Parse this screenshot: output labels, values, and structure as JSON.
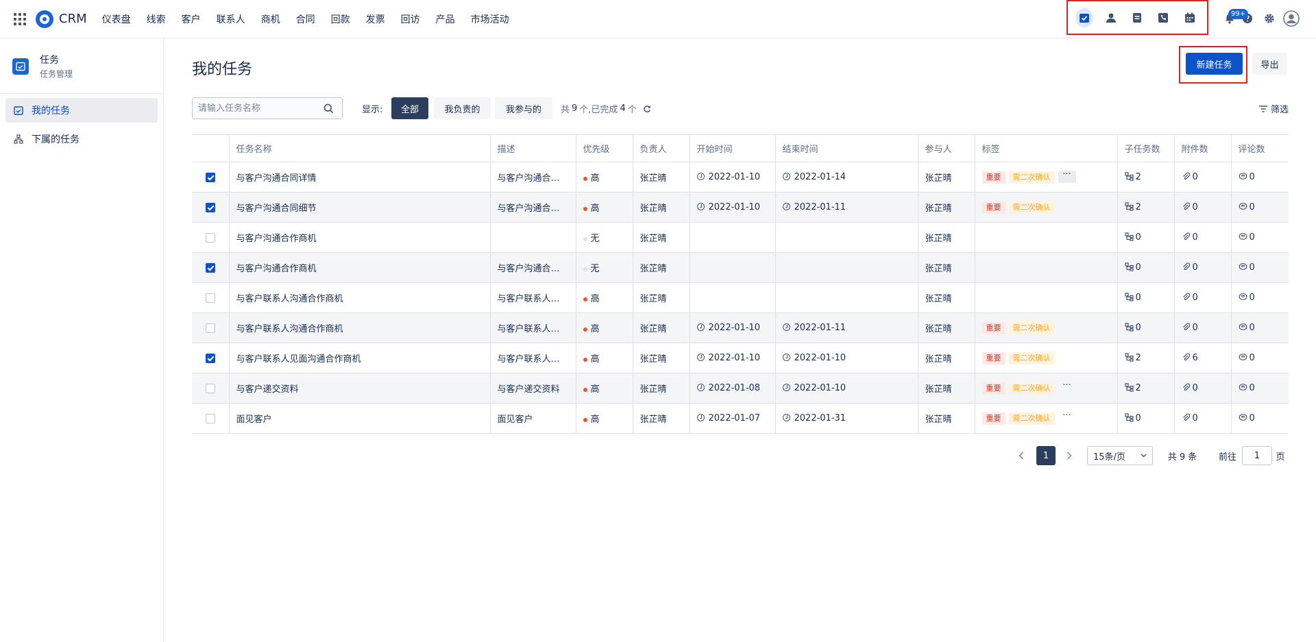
{
  "header": {
    "brand": "CRM",
    "menu": [
      "仪表盘",
      "线索",
      "客户",
      "联系人",
      "商机",
      "合同",
      "回款",
      "发票",
      "回访",
      "产品",
      "市场活动"
    ],
    "quick_icons": [
      "task-icon",
      "contact-icon",
      "document-icon",
      "phone-icon",
      "calendar-icon"
    ],
    "notification_badge": "99+"
  },
  "sidebar": {
    "title": "任务",
    "subtitle": "任务管理",
    "items": [
      {
        "label": "我的任务",
        "icon": "calendar-task-icon",
        "active": true
      },
      {
        "label": "下属的任务",
        "icon": "org-chart-icon",
        "active": false
      }
    ]
  },
  "main": {
    "title": "我的任务",
    "new_button": "新建任务",
    "export_button": "导出",
    "search_placeholder": "请输入任务名称",
    "show_label": "显示:",
    "filters": [
      "全部",
      "我负责的",
      "我参与的"
    ],
    "count_prefix": "共",
    "count_total": "9",
    "count_mid": "个,已完成",
    "count_done": "4",
    "count_suffix": "个",
    "filter_button": "筛选"
  },
  "table": {
    "columns": [
      "任务名称",
      "描述",
      "优先级",
      "负责人",
      "开始时间",
      "结束时间",
      "参与人",
      "标签",
      "子任务数",
      "附件数",
      "评论数"
    ],
    "rows": [
      {
        "checked": true,
        "name": "与客户沟通合同详情",
        "desc": "与客户沟通合…",
        "priority": "高",
        "owner": "张芷晴",
        "start": "2022-01-10",
        "end": "2022-01-14",
        "participant": "张芷晴",
        "tags": [
          "重要",
          "需二次确认"
        ],
        "more": "box",
        "subtasks": "2",
        "attachments": "0",
        "comments": "0"
      },
      {
        "checked": true,
        "name": "与客户沟通合同细节",
        "desc": "与客户沟通合…",
        "priority": "高",
        "owner": "张芷晴",
        "start": "2022-01-10",
        "end": "2022-01-11",
        "participant": "张芷晴",
        "tags": [
          "重要",
          "需二次确认"
        ],
        "more": "",
        "subtasks": "2",
        "attachments": "0",
        "comments": "0"
      },
      {
        "checked": false,
        "name": "与客户沟通合作商机",
        "desc": "",
        "priority": "无",
        "owner": "张芷晴",
        "start": "",
        "end": "",
        "participant": "张芷晴",
        "tags": [],
        "more": "",
        "subtasks": "0",
        "attachments": "0",
        "comments": "0"
      },
      {
        "checked": true,
        "name": "与客户沟通合作商机",
        "desc": "与客户沟通合…",
        "priority": "无",
        "owner": "张芷晴",
        "start": "",
        "end": "",
        "participant": "张芷晴",
        "tags": [],
        "more": "",
        "subtasks": "0",
        "attachments": "0",
        "comments": "0"
      },
      {
        "checked": false,
        "name": "与客户联系人沟通合作商机",
        "desc": "与客户联系人…",
        "priority": "高",
        "owner": "张芷晴",
        "start": "",
        "end": "",
        "participant": "张芷晴",
        "tags": [],
        "more": "",
        "subtasks": "0",
        "attachments": "0",
        "comments": "0"
      },
      {
        "checked": false,
        "name": "与客户联系人沟通合作商机",
        "desc": "与客户联系人…",
        "priority": "高",
        "owner": "张芷晴",
        "start": "2022-01-10",
        "end": "2022-01-11",
        "participant": "张芷晴",
        "tags": [
          "重要",
          "需二次确认"
        ],
        "more": "",
        "subtasks": "0",
        "attachments": "0",
        "comments": "0"
      },
      {
        "checked": true,
        "name": "与客户联系人见面沟通合作商机",
        "desc": "与客户联系人…",
        "priority": "高",
        "owner": "张芷晴",
        "start": "2022-01-10",
        "end": "2022-01-10",
        "participant": "张芷晴",
        "tags": [
          "重要",
          "需二次确认"
        ],
        "more": "",
        "subtasks": "2",
        "attachments": "6",
        "comments": "0"
      },
      {
        "checked": false,
        "name": "与客户递交资料",
        "desc": "与客户递交资料",
        "priority": "高",
        "owner": "张芷晴",
        "start": "2022-01-08",
        "end": "2022-01-10",
        "participant": "张芷晴",
        "tags": [
          "重要",
          "需二次确认"
        ],
        "more": "plain",
        "subtasks": "2",
        "attachments": "0",
        "comments": "0"
      },
      {
        "checked": false,
        "name": "面见客户",
        "desc": "面见客户",
        "priority": "高",
        "owner": "张芷晴",
        "start": "2022-01-07",
        "end": "2022-01-31",
        "participant": "张芷晴",
        "tags": [
          "重要",
          "需二次确认"
        ],
        "more": "plain",
        "subtasks": "0",
        "attachments": "0",
        "comments": "0"
      }
    ]
  },
  "pagination": {
    "current": "1",
    "page_size": "15条/页",
    "total": "共 9 条",
    "goto_label": "前往",
    "goto_value": "1",
    "page_unit": "页"
  },
  "colors": {
    "primary": "#0c52c9",
    "priority_high": "#f0502c",
    "priority_none": "#dfe1e6",
    "highlight_border": "#e02020"
  }
}
